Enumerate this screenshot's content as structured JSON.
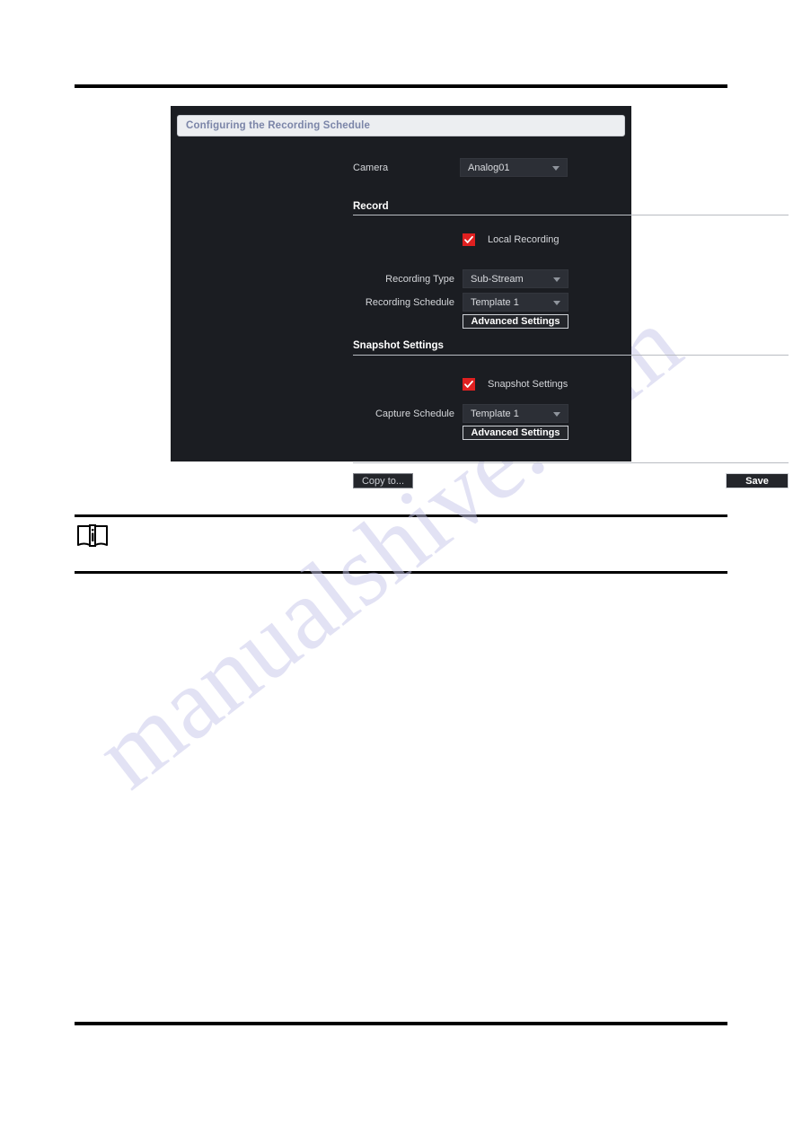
{
  "page": {
    "watermark_text": "manualshive.com",
    "note_icon": "note-book-info-icon"
  },
  "dialog": {
    "title": "Configuring the Recording Schedule",
    "camera": {
      "label": "Camera",
      "value": "Analog01"
    },
    "record_section": {
      "title": "Record",
      "local_recording": {
        "label": "Local Recording",
        "checked": true
      },
      "recording_type": {
        "label": "Recording Type",
        "value": "Sub-Stream"
      },
      "recording_schedule": {
        "label": "Recording Schedule",
        "value": "Template 1"
      },
      "advanced_settings_label": "Advanced Settings"
    },
    "snapshot_section": {
      "title": "Snapshot Settings",
      "snapshot_settings": {
        "label": "Snapshot Settings",
        "checked": true
      },
      "capture_schedule": {
        "label": "Capture Schedule",
        "value": "Template 1"
      },
      "advanced_settings_label": "Advanced Settings"
    },
    "footer": {
      "copy_to_label": "Copy to...",
      "save_label": "Save"
    },
    "colors": {
      "dialog_background": "#1b1d22",
      "titlebar_background": "#eceef1",
      "title_text": "#7b85a8",
      "checkbox_accent": "#e02020",
      "field_background": "#2c2f36"
    }
  }
}
